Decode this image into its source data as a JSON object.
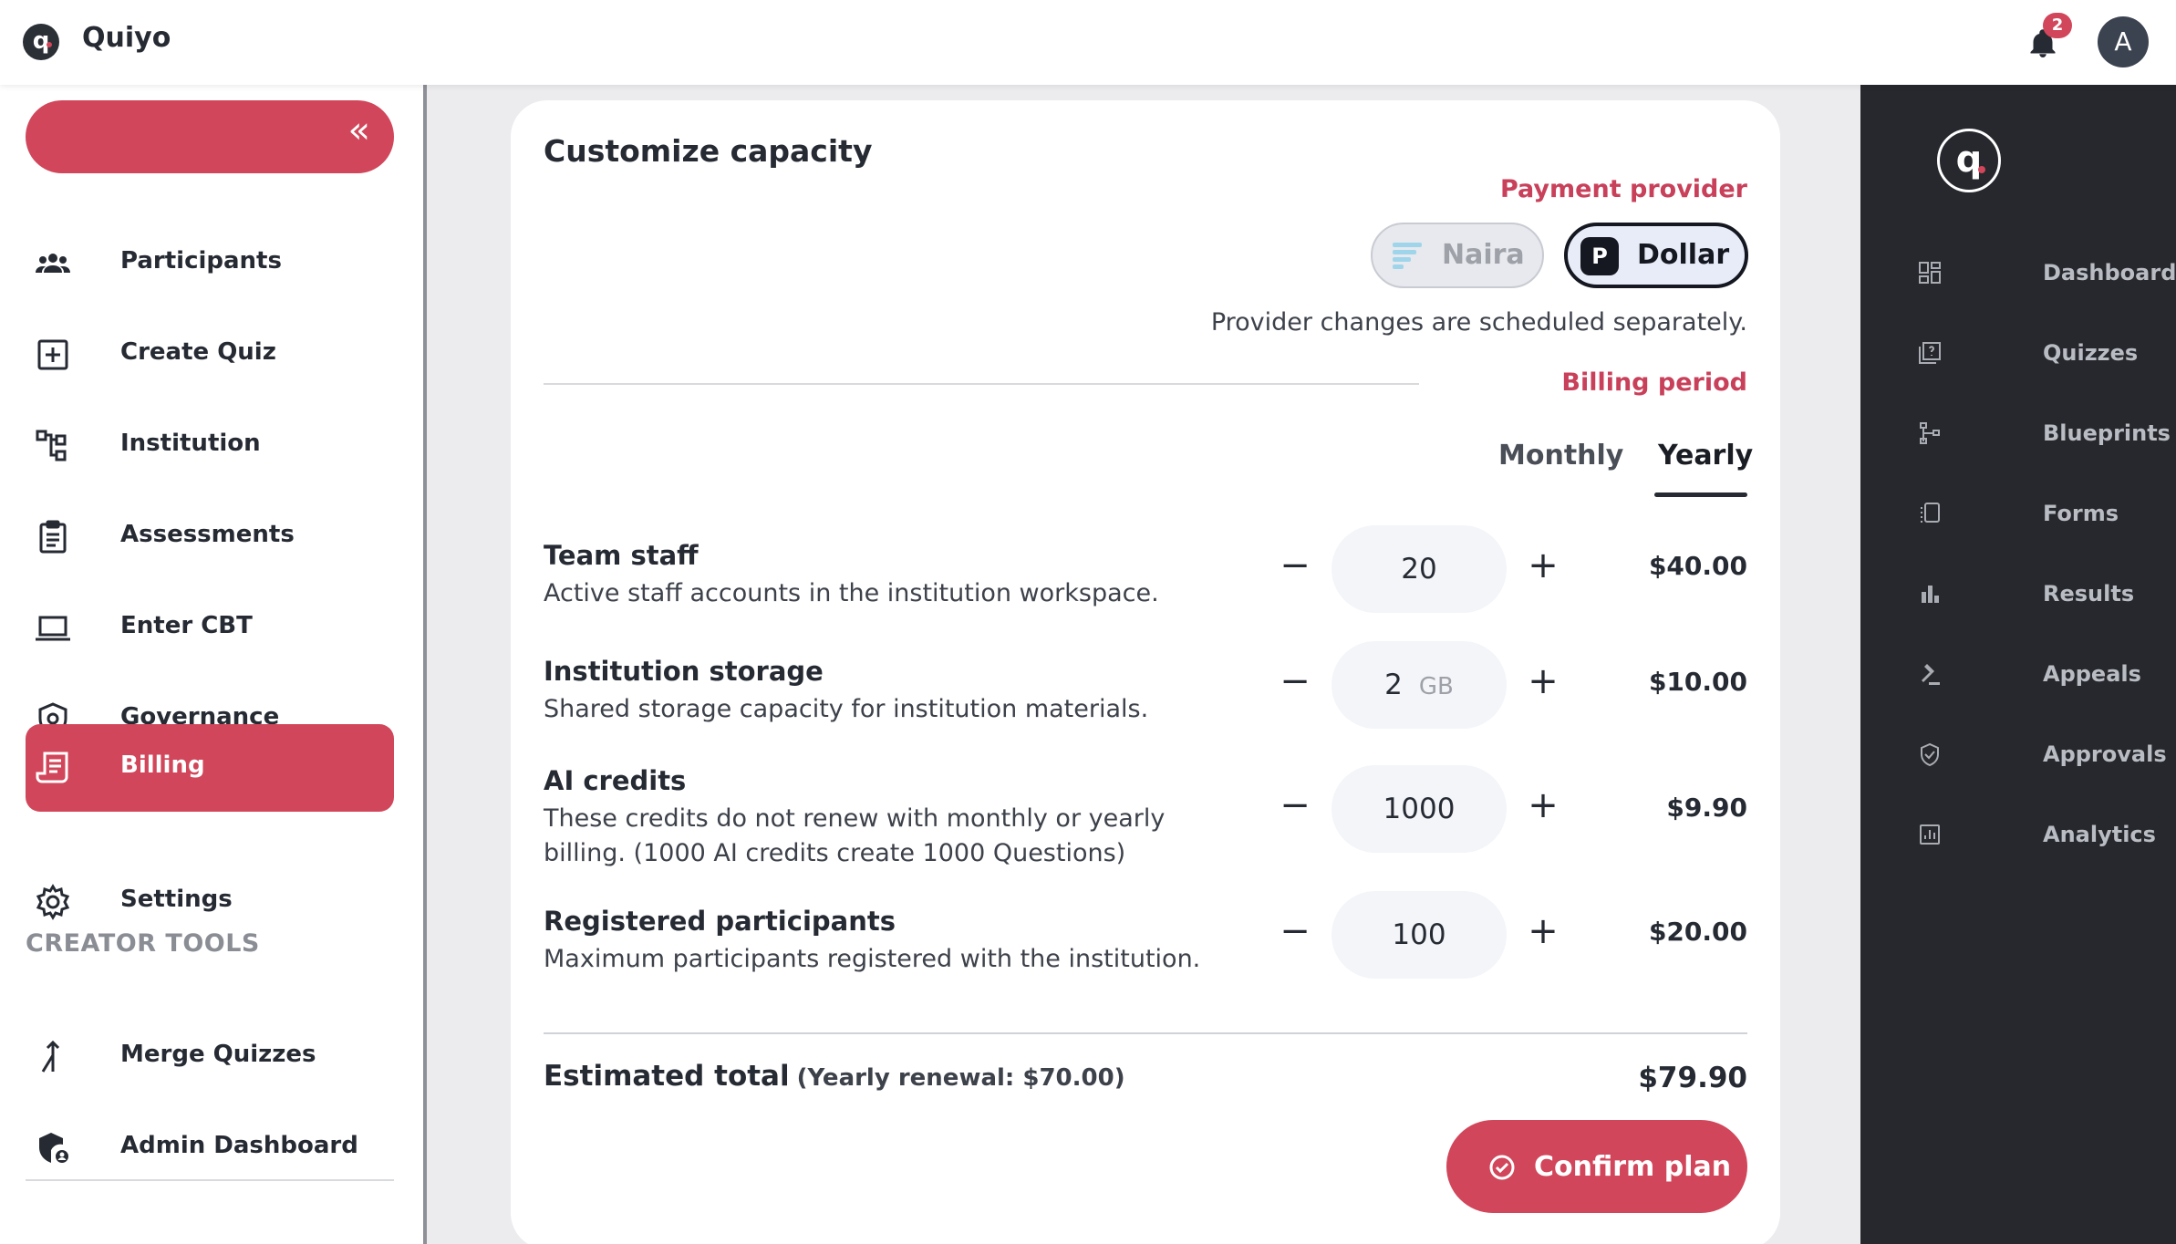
{
  "app": {
    "name": "Quiyo",
    "logo_letter": "q",
    "notifications_count": "2",
    "avatar_letter": "A"
  },
  "sidebar": {
    "collapse_glyph": "«",
    "items": [
      {
        "label": "Participants",
        "icon": "participants-icon"
      },
      {
        "label": "Create Quiz",
        "icon": "add-box-icon"
      },
      {
        "label": "Institution",
        "icon": "hierarchy-icon"
      },
      {
        "label": "Assessments",
        "icon": "clipboard-icon"
      },
      {
        "label": "Enter CBT",
        "icon": "laptop-icon"
      },
      {
        "label": "Governance",
        "icon": "shield-icon"
      },
      {
        "label": "Billing",
        "icon": "receipt-icon",
        "active": true
      },
      {
        "label": "Settings",
        "icon": "gear-icon"
      }
    ],
    "section_title": "CREATOR TOOLS",
    "tools": [
      {
        "label": "Merge Quizzes",
        "icon": "merge-icon"
      },
      {
        "label": "Admin Dashboard",
        "icon": "admin-shield-icon"
      }
    ]
  },
  "card": {
    "title": "Customize capacity",
    "payment_provider_label": "Payment provider",
    "providers": [
      {
        "label": "Naira",
        "selected": false
      },
      {
        "label": "Dollar",
        "badge": "P",
        "selected": true
      }
    ],
    "provider_note": "Provider changes are scheduled separately.",
    "billing_period_label": "Billing period",
    "periods": [
      {
        "label": "Monthly",
        "selected": false
      },
      {
        "label": "Yearly",
        "selected": true
      }
    ],
    "rows": [
      {
        "title": "Team staff",
        "desc": "Active staff accounts in the institution workspace.",
        "value": "20",
        "unit": "",
        "price": "$40.00"
      },
      {
        "title": "Institution storage",
        "desc": "Shared storage capacity for institution materials.",
        "value": "2",
        "unit": "GB",
        "price": "$10.00"
      },
      {
        "title": "AI credits",
        "desc": "These credits do not renew with monthly or yearly billing. (1000 AI credits create 1000 Questions)",
        "value": "1000",
        "unit": "",
        "price": "$9.90"
      },
      {
        "title": "Registered participants",
        "desc": "Maximum participants registered with the institution.",
        "value": "100",
        "unit": "",
        "price": "$20.00"
      }
    ],
    "stepper_minus": "−",
    "stepper_plus": "+",
    "total_label": "Estimated total",
    "renewal_note": "(Yearly renewal: $70.00)",
    "total_price": "$79.90",
    "confirm_label": "Confirm plan"
  },
  "rail": {
    "logo_letter": "q",
    "items": [
      {
        "label": "Dashboard",
        "icon": "dashboard-icon"
      },
      {
        "label": "Quizzes",
        "icon": "quiz-icon"
      },
      {
        "label": "Blueprints",
        "icon": "blueprint-icon"
      },
      {
        "label": "Forms",
        "icon": "forms-icon"
      },
      {
        "label": "Results",
        "icon": "bar-chart-icon"
      },
      {
        "label": "Appeals",
        "icon": "gavel-icon"
      },
      {
        "label": "Approvals",
        "icon": "verified-icon"
      },
      {
        "label": "Analytics",
        "icon": "analytics-icon"
      }
    ]
  },
  "colors": {
    "accent": "#d1465a",
    "rail_bg": "#26282d",
    "text": "#262a33"
  }
}
